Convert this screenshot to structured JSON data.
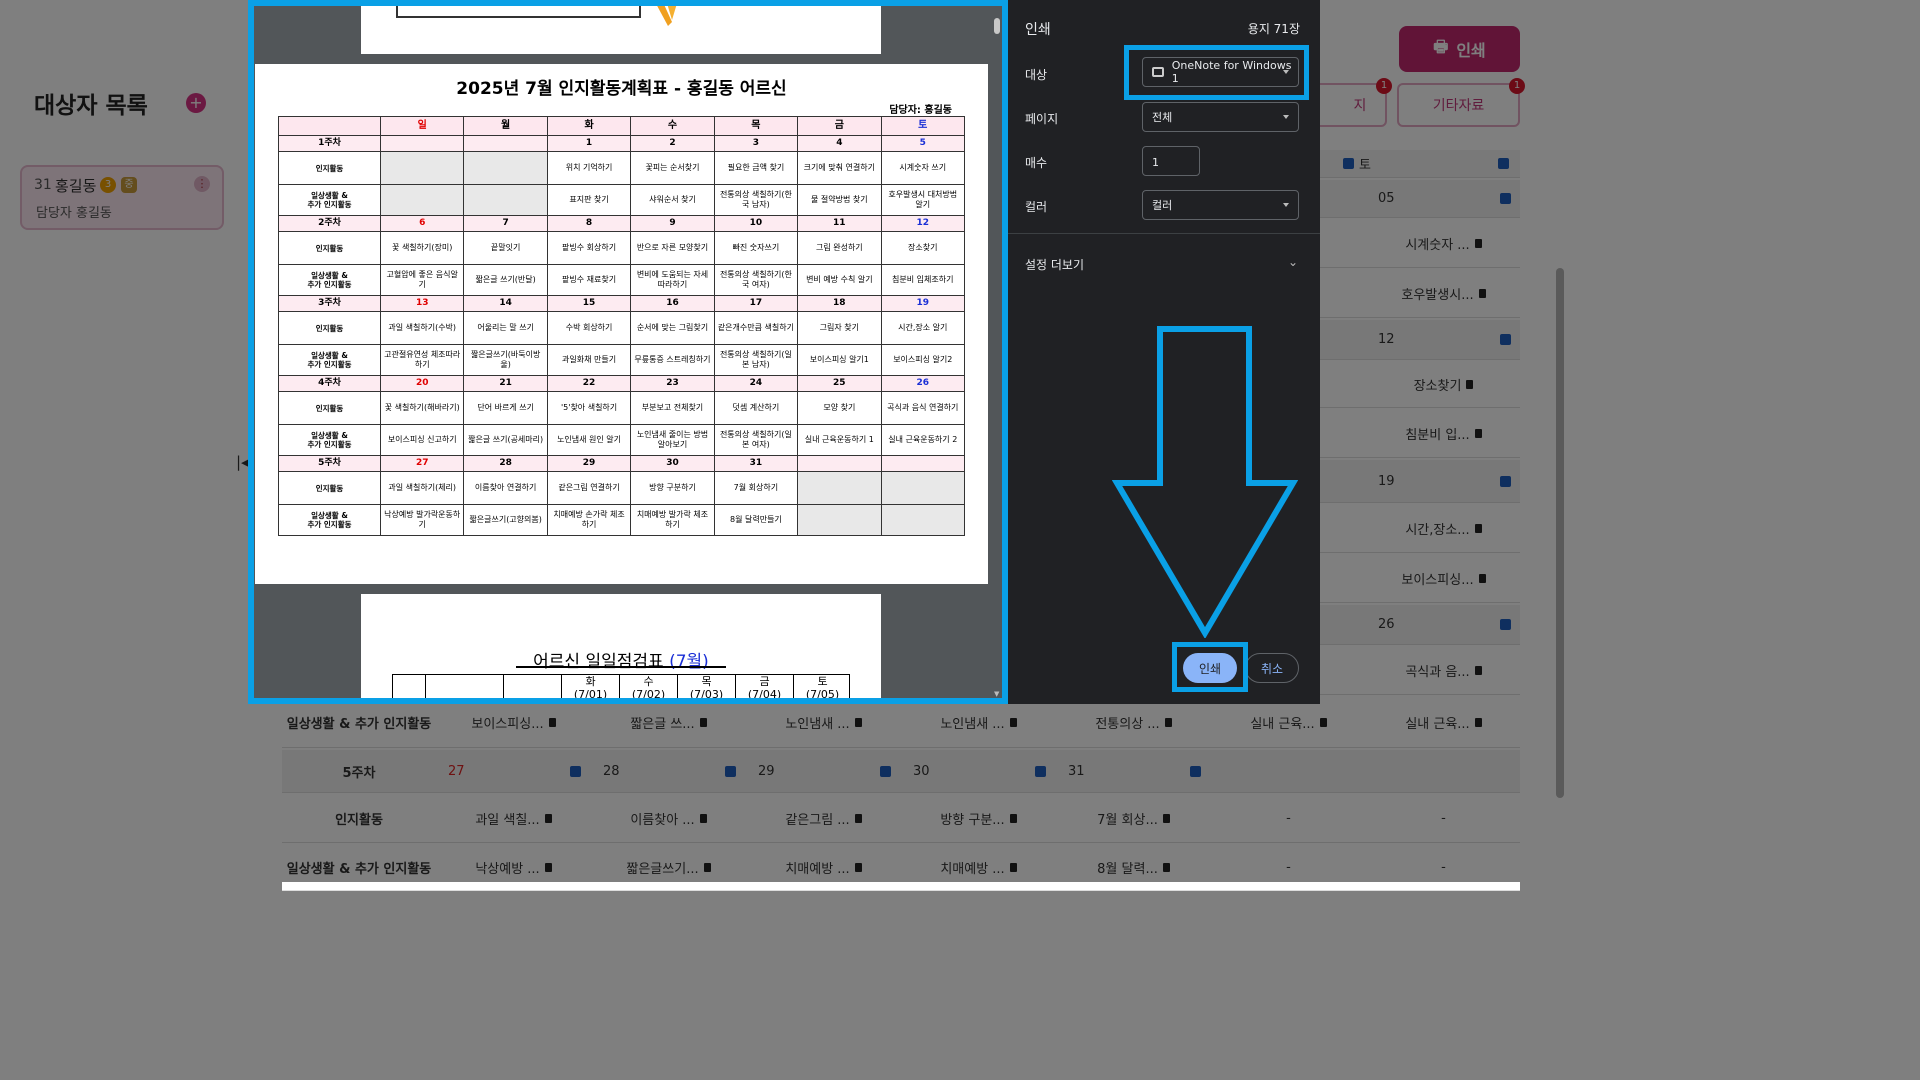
{
  "background": {
    "list_title": "대상자 목록",
    "add_icon": "+",
    "person": {
      "number": "31",
      "name": "홍길동",
      "badge1": "3",
      "badge2": "중",
      "menu": "⋮",
      "manager": "담당자 홍길동"
    },
    "print_button": "인쇄",
    "tabs": [
      {
        "label": "지",
        "badge": "1"
      },
      {
        "label": "기타자료",
        "badge": "1"
      }
    ],
    "collapse_icon": "|◂",
    "sat_label": "토",
    "rows": [
      {
        "label": "",
        "cells": [
          "",
          "",
          "",
          "",
          "",
          "",
          "05"
        ]
      },
      {
        "label": "",
        "cells": [
          "",
          "",
          "",
          "",
          "",
          "",
          "시계숫자 ..."
        ]
      },
      {
        "label": "",
        "cells": [
          "",
          "",
          "",
          "",
          "",
          "",
          "호우발생시..."
        ]
      },
      {
        "label": "",
        "cells": [
          "",
          "",
          "",
          "",
          "",
          "",
          "12"
        ]
      },
      {
        "label": "",
        "cells": [
          "",
          "",
          "",
          "",
          "",
          "",
          "장소찾기"
        ]
      },
      {
        "label": "",
        "cells": [
          "",
          "",
          "",
          "",
          "",
          "",
          "침분비 입..."
        ]
      },
      {
        "label": "",
        "cells": [
          "",
          "",
          "",
          "",
          "",
          "",
          "19"
        ]
      },
      {
        "label": "",
        "cells": [
          "",
          "",
          "",
          "",
          "",
          "",
          "시간,장소..."
        ]
      },
      {
        "label": "",
        "cells": [
          "",
          "",
          "",
          "",
          "",
          "",
          "보이스피싱..."
        ]
      },
      {
        "label": "",
        "cells": [
          "",
          "",
          "",
          "",
          "",
          "",
          "26"
        ]
      },
      {
        "label": "",
        "cells": [
          "",
          "",
          "",
          "",
          "",
          "",
          "곡식과 음..."
        ]
      },
      {
        "label": "일상생활 & 추가 인지활동",
        "cells": [
          "보이스피싱...",
          "짧은글 쓰...",
          "노인냄새 ...",
          "노인냄새 ...",
          "전통의상 ...",
          "실내 근육...",
          "실내 근육..."
        ]
      },
      {
        "label": "5주차",
        "cells": [
          "27",
          "28",
          "29",
          "30",
          "31",
          "",
          ""
        ]
      },
      {
        "label": "인지활동",
        "cells": [
          "과일 색칠...",
          "이름찾아 ...",
          "같은그림 ...",
          "방향 구분...",
          "7월 회상...",
          "-",
          "-"
        ]
      },
      {
        "label": "일상생활 & 추가 인지활동",
        "cells": [
          "낙상예방 ...",
          "짧은글쓰기...",
          "치매예방 ...",
          "치매예방 ...",
          "8월 달력...",
          "-",
          "-"
        ]
      }
    ]
  },
  "dialog": {
    "title": "인쇄",
    "sheets": "용지 71장",
    "destination_label": "대상",
    "destination_value": "OneNote for Windows 1",
    "pages_label": "페이지",
    "pages_value": "전체",
    "copies_label": "매수",
    "copies_value": "1",
    "color_label": "컬러",
    "color_value": "컬러",
    "more_settings": "설정 더보기",
    "more_chevron": "⌄",
    "print_button": "인쇄",
    "cancel_button": "취소",
    "colors": {
      "highlight": "#0aa0e6",
      "print_button_bg": "#8ab4f8"
    }
  },
  "preview": {
    "plan_title": "2025년 7월 인지활동계획표 - 홍길동 어르신",
    "manager": "담당자: 홍길동",
    "days": [
      "일",
      "월",
      "화",
      "수",
      "목",
      "금",
      "토"
    ],
    "weeks": [
      {
        "label": "1주차",
        "dates": [
          "",
          "",
          "1",
          "2",
          "3",
          "4",
          "5"
        ],
        "activity": [
          "",
          "",
          "위치 기억하기",
          "꽃피는 순서찾기",
          "필요한 금액 찾기",
          "크기에 맞춰 연결하기",
          "시계숫자 쓰기"
        ],
        "daily": [
          "",
          "",
          "표지판 찾기",
          "샤워순서 찾기",
          "전통의상 색칠하기(한국 남자)",
          "물 절약방법 찾기",
          "호우발생시 대처방법 알기"
        ]
      },
      {
        "label": "2주차",
        "dates": [
          "6",
          "7",
          "8",
          "9",
          "10",
          "11",
          "12"
        ],
        "activity": [
          "꽃 색칠하기(장미)",
          "끝말잇기",
          "팥빙수 회상하기",
          "반으로 자른 모양찾기",
          "빠진 숫자쓰기",
          "그림 완성하기",
          "장소찾기"
        ],
        "daily": [
          "고혈압에 좋은 음식알기",
          "짧은글 쓰기(반달)",
          "팥빙수 재료찾기",
          "변비에 도움되는 자세 따라하기",
          "전통의상 색칠하기(한국 여자)",
          "변비 예방 수칙 알기",
          "침분비 입체조하기"
        ]
      },
      {
        "label": "3주차",
        "dates": [
          "13",
          "14",
          "15",
          "16",
          "17",
          "18",
          "19"
        ],
        "activity": [
          "과일 색칠하기(수박)",
          "어울리는 말 쓰기",
          "수박 회상하기",
          "순서에 맞는 그림찾기",
          "같은개수만큼 색칠하기",
          "그림자 찾기",
          "시간,장소 알기"
        ],
        "daily": [
          "고관절유연성 체조따라하기",
          "짧은글쓰기(바둑이방울)",
          "과일화채 만들기",
          "무릎통증 스트레칭하기",
          "전통의상 색칠하기(일본 남자)",
          "보이스피싱 알기1",
          "보이스피싱 알기2"
        ]
      },
      {
        "label": "4주차",
        "dates": [
          "20",
          "21",
          "22",
          "23",
          "24",
          "25",
          "26"
        ],
        "activity": [
          "꽃 색칠하기(해바라기)",
          "단어 바르게 쓰기",
          "'5'찾아 색칠하기",
          "부분보고 전체찾기",
          "덧셈 계산하기",
          "모양 찾기",
          "곡식과 음식 연결하기"
        ],
        "daily": [
          "보이스피싱 신고하기",
          "짧은글 쓰기(공세마리)",
          "노인냄새 원인 알기",
          "노인냄새 줄이는 방법 알아보기",
          "전통의상 색칠하기(일본 여자)",
          "실내 근육운동하기 1",
          "실내 근육운동하기 2"
        ]
      },
      {
        "label": "5주차",
        "dates": [
          "27",
          "28",
          "29",
          "30",
          "31",
          "",
          ""
        ],
        "activity": [
          "과일 색칠하기(체리)",
          "이름찾아 연결하기",
          "같은그림 연결하기",
          "방향 구분하기",
          "7월 회상하기",
          "",
          ""
        ],
        "daily": [
          "낙상예방 발가락운동하기",
          "짧은글쓰기(고향의봄)",
          "치매예방 손가락 체조하기",
          "치매예방 발가락 체조하기",
          "8월 달력만들기",
          "",
          ""
        ]
      }
    ],
    "activity_label": "인지활동",
    "daily_label_1": "일상생활 &",
    "daily_label_2": "추가 인지활동",
    "next_title": "어르신 일일점검표",
    "next_title_month": "(7월)",
    "next_days": [
      {
        "day": "화",
        "date": "(7/01)"
      },
      {
        "day": "수",
        "date": "(7/02)"
      },
      {
        "day": "목",
        "date": "(7/03)"
      },
      {
        "day": "금",
        "date": "(7/04)"
      },
      {
        "day": "토",
        "date": "(7/05)"
      }
    ]
  }
}
